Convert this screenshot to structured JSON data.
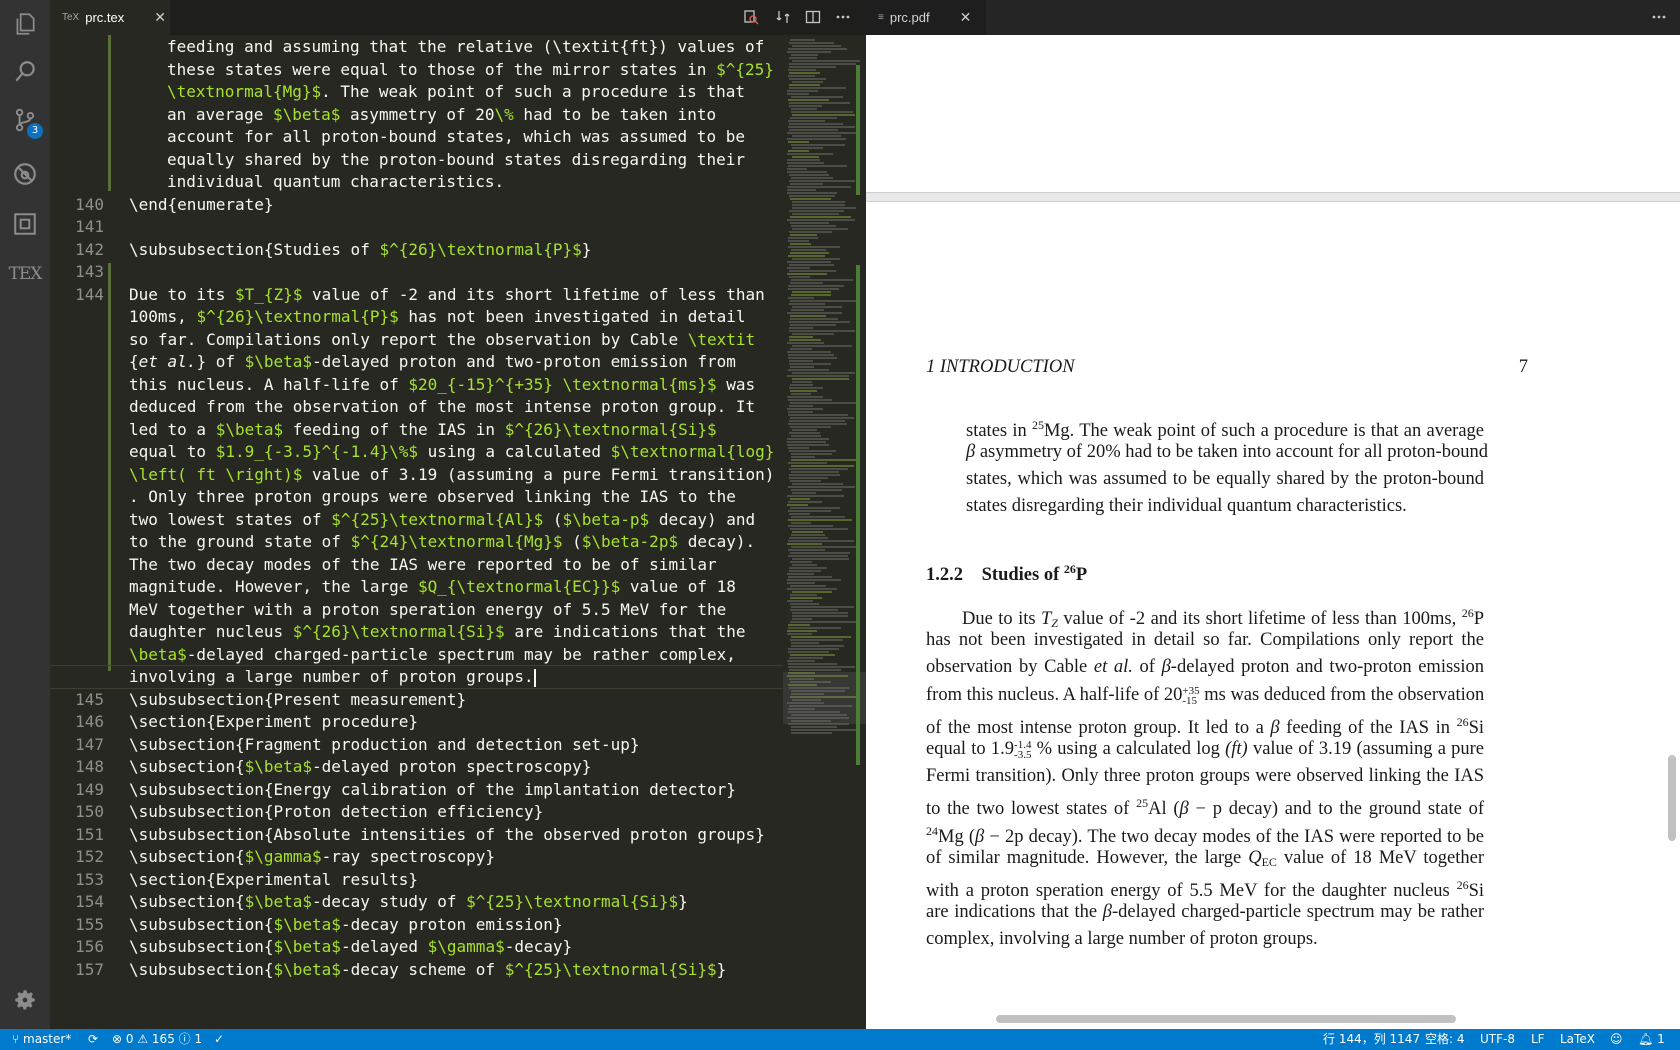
{
  "editor": {
    "tab_label": "prc.tex",
    "tab_icon": "TeX",
    "lines": [
      {
        "n": "",
        "indent": true,
        "segs": [
          [
            "t",
            "feeding and assuming that the relative (\\textit{ft}) values of"
          ]
        ]
      },
      {
        "n": "",
        "indent": true,
        "segs": [
          [
            "t",
            "these states were equal to those of the mirror states in "
          ],
          [
            "m",
            "$^{25}"
          ]
        ]
      },
      {
        "n": "",
        "indent": true,
        "segs": [
          [
            "m",
            "\\textnormal{Mg}$"
          ],
          [
            "t",
            ". The weak point of such a procedure is that"
          ]
        ]
      },
      {
        "n": "",
        "indent": true,
        "segs": [
          [
            "t",
            "an average "
          ],
          [
            "m",
            "$\\beta$"
          ],
          [
            "t",
            " asymmetry of 20"
          ],
          [
            "m",
            "\\%"
          ],
          [
            "t",
            " had to be taken into"
          ]
        ]
      },
      {
        "n": "",
        "indent": true,
        "segs": [
          [
            "t",
            "account for all proton-bound states, which was assumed to be"
          ]
        ]
      },
      {
        "n": "",
        "indent": true,
        "segs": [
          [
            "t",
            "equally shared by the proton-bound states disregarding their"
          ]
        ]
      },
      {
        "n": "",
        "indent": true,
        "segs": [
          [
            "t",
            "individual quantum characteristics."
          ]
        ]
      },
      {
        "n": "140",
        "segs": [
          [
            "t",
            "\\end{"
          ],
          [
            "t",
            "enumerate"
          ],
          [
            "t",
            "}"
          ]
        ]
      },
      {
        "n": "141",
        "segs": []
      },
      {
        "n": "142",
        "segs": [
          [
            "t",
            "\\subsubsection{Studies of "
          ],
          [
            "m",
            "$^{26}\\textnormal{P}$"
          ],
          [
            "t",
            "}"
          ]
        ]
      },
      {
        "n": "143",
        "segs": []
      },
      {
        "n": "144",
        "segs": [
          [
            "t",
            "Due to its "
          ],
          [
            "m",
            "$T_{Z}$"
          ],
          [
            "t",
            " value of -2 and its short lifetime of less than"
          ]
        ]
      },
      {
        "n": "",
        "segs": [
          [
            "t",
            "100ms, "
          ],
          [
            "m",
            "$^{26}\\textnormal{P}$"
          ],
          [
            "t",
            " has not been investigated in detail"
          ]
        ]
      },
      {
        "n": "",
        "segs": [
          [
            "t",
            "so far. Compilations only report the observation by Cable "
          ],
          [
            "k",
            "\\textit"
          ]
        ]
      },
      {
        "n": "",
        "segs": [
          [
            "t",
            "{"
          ],
          [
            "i",
            "et al."
          ],
          [
            "t",
            "} of "
          ],
          [
            "m",
            "$\\beta$"
          ],
          [
            "t",
            "-delayed proton and two-proton emission from"
          ]
        ]
      },
      {
        "n": "",
        "segs": [
          [
            "t",
            "this nucleus. A half-life of "
          ],
          [
            "m",
            "$20_{-15}^{+35} \\textnormal{ms}$"
          ],
          [
            "t",
            " was"
          ]
        ]
      },
      {
        "n": "",
        "segs": [
          [
            "t",
            "deduced from the observation of the most intense proton group. It"
          ]
        ]
      },
      {
        "n": "",
        "segs": [
          [
            "t",
            "led to a "
          ],
          [
            "m",
            "$\\beta$"
          ],
          [
            "t",
            " feeding of the IAS in "
          ],
          [
            "m",
            "$^{26}\\textnormal{Si}$"
          ]
        ]
      },
      {
        "n": "",
        "segs": [
          [
            "t",
            "equal to "
          ],
          [
            "m",
            "$1.9_{-3.5}^{-1.4}\\%$"
          ],
          [
            "t",
            " using a calculated "
          ],
          [
            "m",
            "$\\textnormal{log}"
          ]
        ]
      },
      {
        "n": "",
        "segs": [
          [
            "m",
            "\\left( ft \\right)$"
          ],
          [
            "t",
            " value of 3.19 (assuming a pure Fermi transition)"
          ]
        ]
      },
      {
        "n": "",
        "segs": [
          [
            "t",
            ". Only three proton groups were observed linking the IAS to the"
          ]
        ]
      },
      {
        "n": "",
        "segs": [
          [
            "t",
            "two lowest states of "
          ],
          [
            "m",
            "$^{25}\\textnormal{Al}$"
          ],
          [
            "t",
            " ("
          ],
          [
            "m",
            "$\\beta-p$"
          ],
          [
            "t",
            " decay) and"
          ]
        ]
      },
      {
        "n": "",
        "segs": [
          [
            "t",
            "to the ground state of "
          ],
          [
            "m",
            "$^{24}\\textnormal{Mg}$"
          ],
          [
            "t",
            " ("
          ],
          [
            "m",
            "$\\beta-2p$"
          ],
          [
            "t",
            " decay)."
          ]
        ]
      },
      {
        "n": "",
        "segs": [
          [
            "t",
            "The two decay modes of the IAS were reported to be of similar"
          ]
        ]
      },
      {
        "n": "",
        "segs": [
          [
            "t",
            "magnitude. However, the large "
          ],
          [
            "m",
            "$Q_{\\textnormal{EC}}$"
          ],
          [
            "t",
            " value of 18"
          ]
        ]
      },
      {
        "n": "",
        "segs": [
          [
            "t",
            "MeV together with a proton speration energy of 5.5 MeV for the"
          ]
        ]
      },
      {
        "n": "",
        "segs": [
          [
            "t",
            "daughter nucleus "
          ],
          [
            "m",
            "$^{26}\\textnormal{Si}$"
          ],
          [
            "t",
            " are indications that the"
          ]
        ]
      },
      {
        "n": "",
        "segs": [
          [
            "m",
            "\\beta$"
          ],
          [
            "t",
            "-delayed charged-particle spectrum may be rather complex,"
          ]
        ]
      },
      {
        "n": "",
        "cursor": true,
        "segs": [
          [
            "t",
            "involving a large number of proton groups."
          ]
        ]
      },
      {
        "n": "145",
        "segs": [
          [
            "t",
            "\\subsubsection{Present measurement}"
          ]
        ]
      },
      {
        "n": "146",
        "segs": [
          [
            "t",
            "\\section{Experiment procedure}"
          ]
        ]
      },
      {
        "n": "147",
        "segs": [
          [
            "t",
            "\\subsection{Fragment production and detection set-up}"
          ]
        ]
      },
      {
        "n": "148",
        "segs": [
          [
            "t",
            "\\subsection{"
          ],
          [
            "m",
            "$\\beta$"
          ],
          [
            "t",
            "-delayed proton spectroscopy}"
          ]
        ]
      },
      {
        "n": "149",
        "segs": [
          [
            "t",
            "\\subsubsection{Energy calibration of the implantation detector}"
          ]
        ]
      },
      {
        "n": "150",
        "segs": [
          [
            "t",
            "\\subsubsection{Proton detection efficiency}"
          ]
        ]
      },
      {
        "n": "151",
        "segs": [
          [
            "t",
            "\\subsubsection{Absolute intensities of the observed proton groups}"
          ]
        ]
      },
      {
        "n": "152",
        "segs": [
          [
            "t",
            "\\subsection{"
          ],
          [
            "m",
            "$\\gamma$"
          ],
          [
            "t",
            "-ray spectroscopy}"
          ]
        ]
      },
      {
        "n": "153",
        "segs": [
          [
            "t",
            "\\section{Experimental results}"
          ]
        ]
      },
      {
        "n": "154",
        "segs": [
          [
            "t",
            "\\subsection{"
          ],
          [
            "m",
            "$\\beta$"
          ],
          [
            "t",
            "-decay study of "
          ],
          [
            "m",
            "$^{25}\\textnormal{Si}$"
          ],
          [
            "t",
            "}"
          ]
        ]
      },
      {
        "n": "155",
        "segs": [
          [
            "t",
            "\\subsubsection{"
          ],
          [
            "m",
            "$\\beta$"
          ],
          [
            "t",
            "-decay proton emission}"
          ]
        ]
      },
      {
        "n": "156",
        "segs": [
          [
            "t",
            "\\subsubsection{"
          ],
          [
            "m",
            "$\\beta$"
          ],
          [
            "t",
            "-delayed "
          ],
          [
            "m",
            "$\\gamma$"
          ],
          [
            "t",
            "-decay}"
          ]
        ]
      },
      {
        "n": "157",
        "segs": [
          [
            "t",
            "\\subsubsection{"
          ],
          [
            "m",
            "$\\beta$"
          ],
          [
            "t",
            "-decay scheme of "
          ],
          [
            "m",
            "$^{25}\\textnormal{Si}$"
          ],
          [
            "t",
            "}"
          ]
        ]
      }
    ]
  },
  "preview": {
    "tab_label": "prc.pdf",
    "running_head": "1   INTRODUCTION",
    "page_number": "7",
    "para1": [
      "states in ^25Mg. The weak point of such a procedure is that an average",
      "β asymmetry of 20% had to be taken into account for all proton-bound",
      "states, which was assumed to be equally shared by the proton-bound",
      "states disregarding their individual quantum characteristics."
    ],
    "section_number": "1.2.2",
    "section_title": "Studies of ^26P",
    "para2": [
      "Due to its T_Z value of -2 and its short lifetime of less than 100ms, ^26P",
      "has not been investigated in detail so far.  Compilations only report the",
      "observation by Cable et al. of β-delayed proton and two-proton emission",
      "from this nucleus. A half-life of 20 +35/-15 ms was deduced from the observation",
      "of the most intense proton group. It led to a β feeding of the IAS in ^26Si",
      "equal to 1.9 -1.4/-3.5 % using a calculated log (ft) value of 3.19 (assuming a pure",
      "Fermi transition). Only three proton groups were observed linking the IAS",
      "to the two lowest states of ^25Al (β − p decay) and to the ground state of",
      "^24Mg (β − 2p decay). The two decay modes of the IAS were reported to be",
      "of similar magnitude.  However, the large Q_EC value of 18 MeV together",
      "with a proton speration energy of 5.5 MeV for the daughter nucleus ^26Si",
      "are indications that the β-delayed charged-particle spectrum may be rather",
      "complex, involving a large number of proton groups."
    ]
  },
  "status": {
    "branch": "master*",
    "errors": "0",
    "warnings": "165",
    "info": "1",
    "position": "行 144，列 1147",
    "indent": "空格: 4",
    "encoding": "UTF-8",
    "eol": "LF",
    "language": "LaTeX",
    "notifications": "1"
  },
  "activity": {
    "scm_badge": "3",
    "tex_label": "TEX"
  },
  "colors": {
    "accent": "#007acc",
    "editor_bg": "#272822",
    "math": "#a6e22e",
    "keyword": "#66d9ef"
  }
}
